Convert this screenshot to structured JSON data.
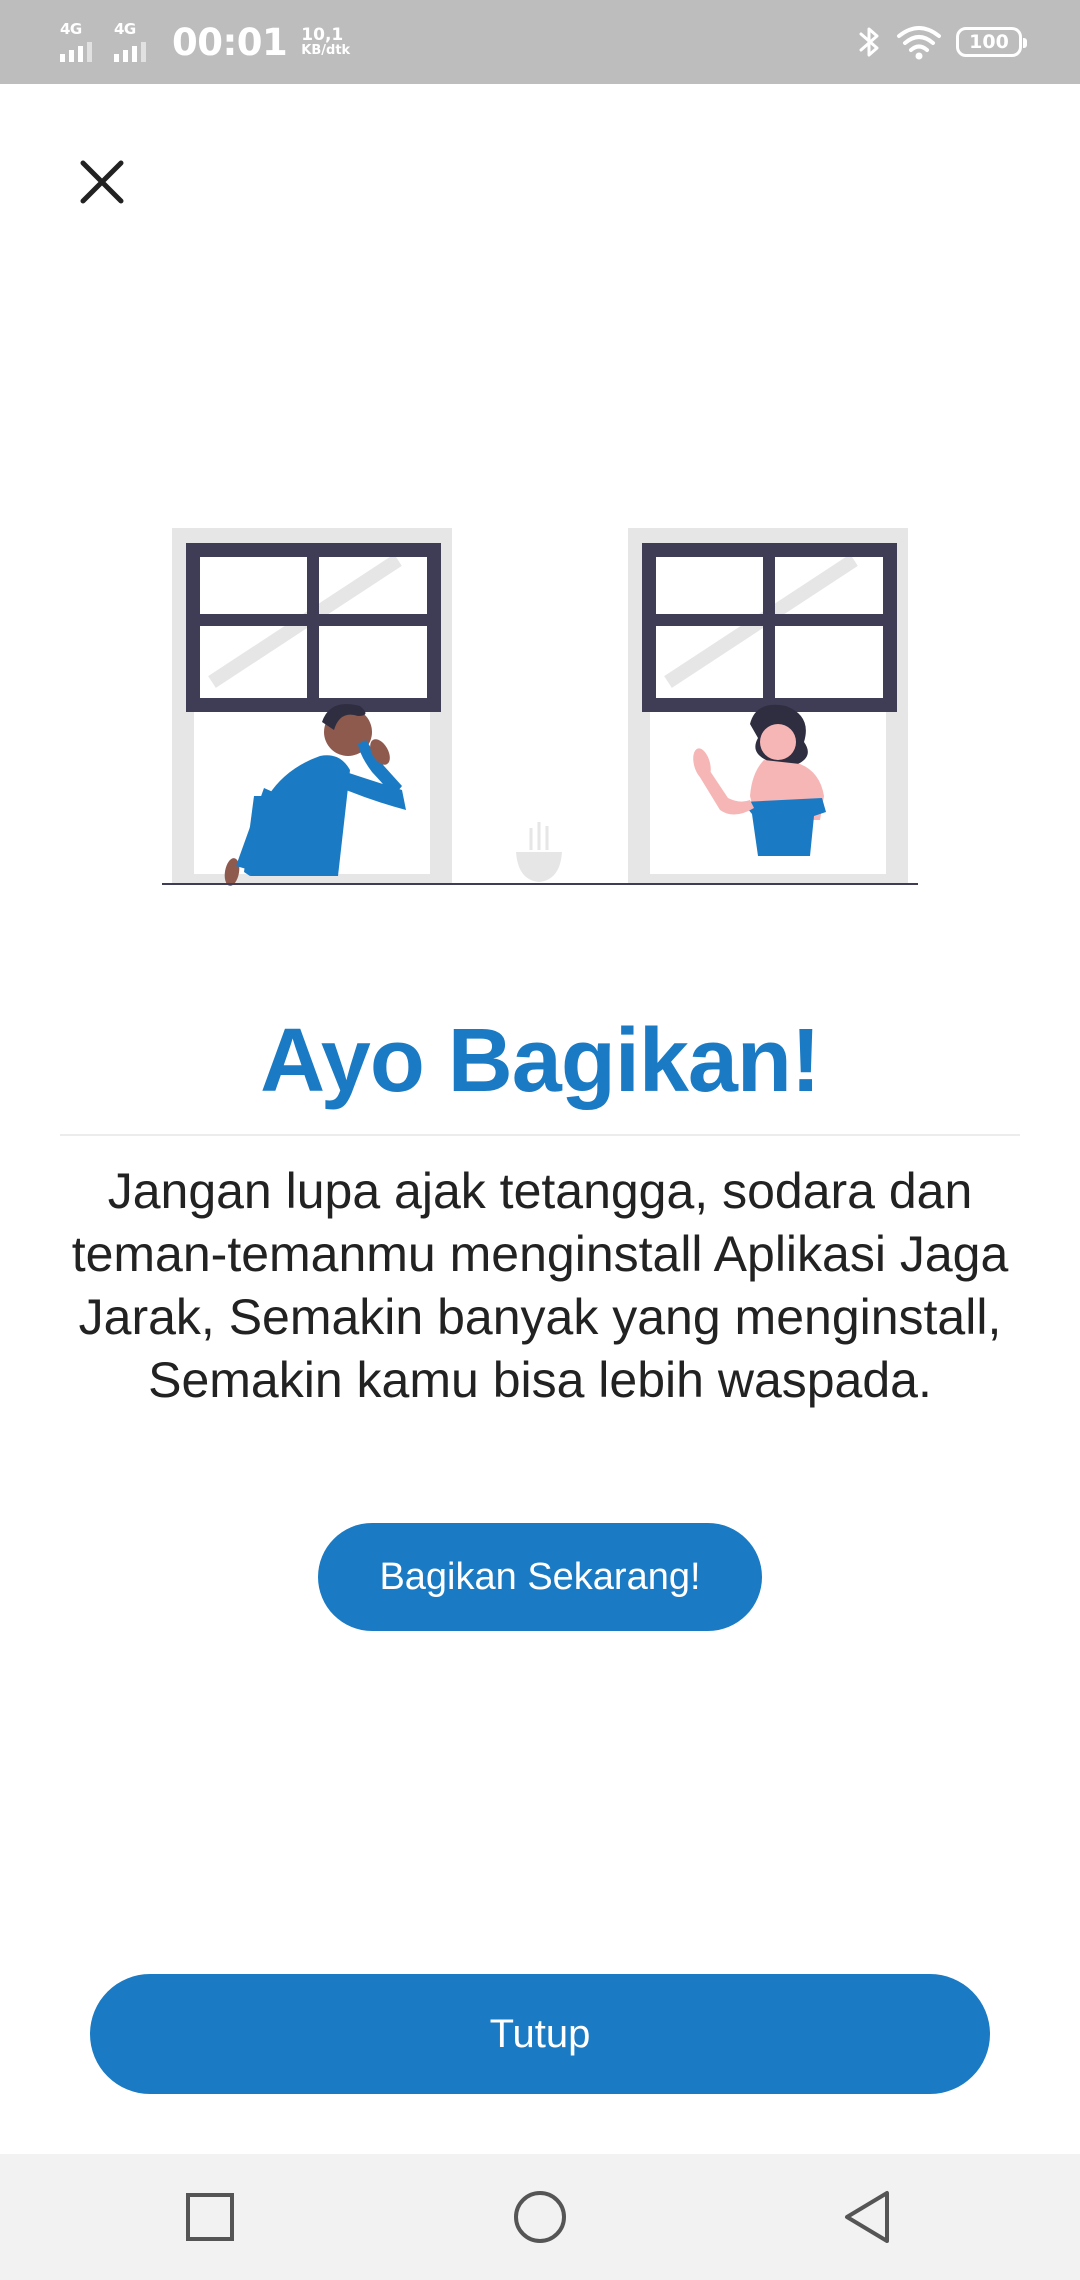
{
  "status_bar": {
    "network_1": "4G",
    "network_2": "4G",
    "time": "00:01",
    "speed_value": "10,1",
    "speed_unit": "KB/dtk",
    "battery": "100",
    "icons": [
      "bluetooth-icon",
      "wifi-icon",
      "battery-icon"
    ]
  },
  "close_icon": "close-icon",
  "illustration": {
    "name": "neighbors-at-windows",
    "colors": {
      "frame": "#e6e6e6",
      "window": "#3f3d56",
      "shirt": "#1a7bc4",
      "skin_dark": "#8f5a4e",
      "skin_light": "#f6b6b6",
      "hair": "#2f2e41"
    }
  },
  "content": {
    "title": "Ayo Bagikan!",
    "body": "Jangan lupa ajak tetangga, sodara dan teman-temanmu menginstall Aplikasi Jaga Jarak, Semakin banyak yang menginstall, Semakin kamu bisa lebih waspada.",
    "share_button": "Bagikan Sekarang!",
    "close_button": "Tutup"
  },
  "colors": {
    "accent": "#1a7bc4",
    "status_bar": "#bdbdbd",
    "nav_bar": "#f2f2f2"
  },
  "nav_bar": {
    "icons": [
      "recent-apps-icon",
      "home-icon",
      "back-icon"
    ]
  }
}
